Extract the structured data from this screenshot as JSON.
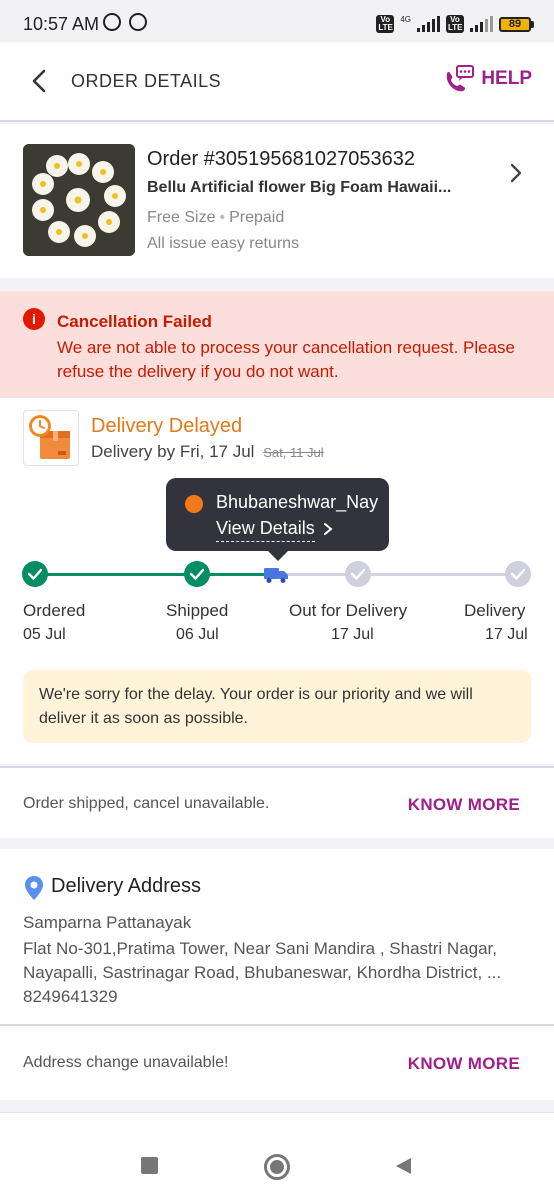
{
  "status_bar": {
    "time": "10:57 AM",
    "network": "4G",
    "volte_label": "Vo LTE",
    "battery": "89"
  },
  "header": {
    "title": "ORDER DETAILS",
    "help_label": "HELP"
  },
  "order": {
    "number": "Order #305195681027053632",
    "product_name": "Bellu Artificial flower Big Foam Hawaii...",
    "size": "Free Size",
    "payment": "Prepaid",
    "returns": "All issue easy returns"
  },
  "cancellation": {
    "title": "Cancellation Failed",
    "message": "We are not able to process your cancellation request. Please refuse the delivery if you do not want."
  },
  "delivery": {
    "status": "Delivery Delayed",
    "by_label": "Delivery by",
    "new_date": "Fri, 17 Jul",
    "old_date": "Sat, 11 Jul",
    "tooltip_location": "Bhubaneshwar_Nay",
    "tooltip_link": "View Details",
    "steps": [
      {
        "label": "Ordered",
        "date": "05 Jul",
        "state": "done"
      },
      {
        "label": "Shipped",
        "date": "06 Jul",
        "state": "done"
      },
      {
        "label": "Out for Delivery",
        "date": "17 Jul",
        "state": "current"
      },
      {
        "label": "Delivery",
        "date": "17 Jul",
        "state": "pending"
      }
    ],
    "apology": "We're sorry for the delay. Your order is our priority and we will deliver it as soon as possible."
  },
  "cancel_row": {
    "text": "Order shipped, cancel unavailable.",
    "link": "KNOW MORE"
  },
  "address": {
    "title": "Delivery Address",
    "name": "Samparna Pattanayak",
    "line1": "Flat No-301,Pratima Tower, Near Sani Mandira , Shastri Nagar,",
    "line2": "Nayapalli, Sastrinagar Road, Bhubaneswar, Khordha District, ...",
    "phone": "8249641329"
  },
  "address_row": {
    "text": "Address change unavailable!",
    "link": "KNOW MORE"
  },
  "colors": {
    "brand": "#9f2089",
    "success": "#038d63",
    "warning": "#e07a18",
    "error": "#c41c00",
    "error_bg": "#fcdedd",
    "notice_bg": "#fff4d9"
  }
}
